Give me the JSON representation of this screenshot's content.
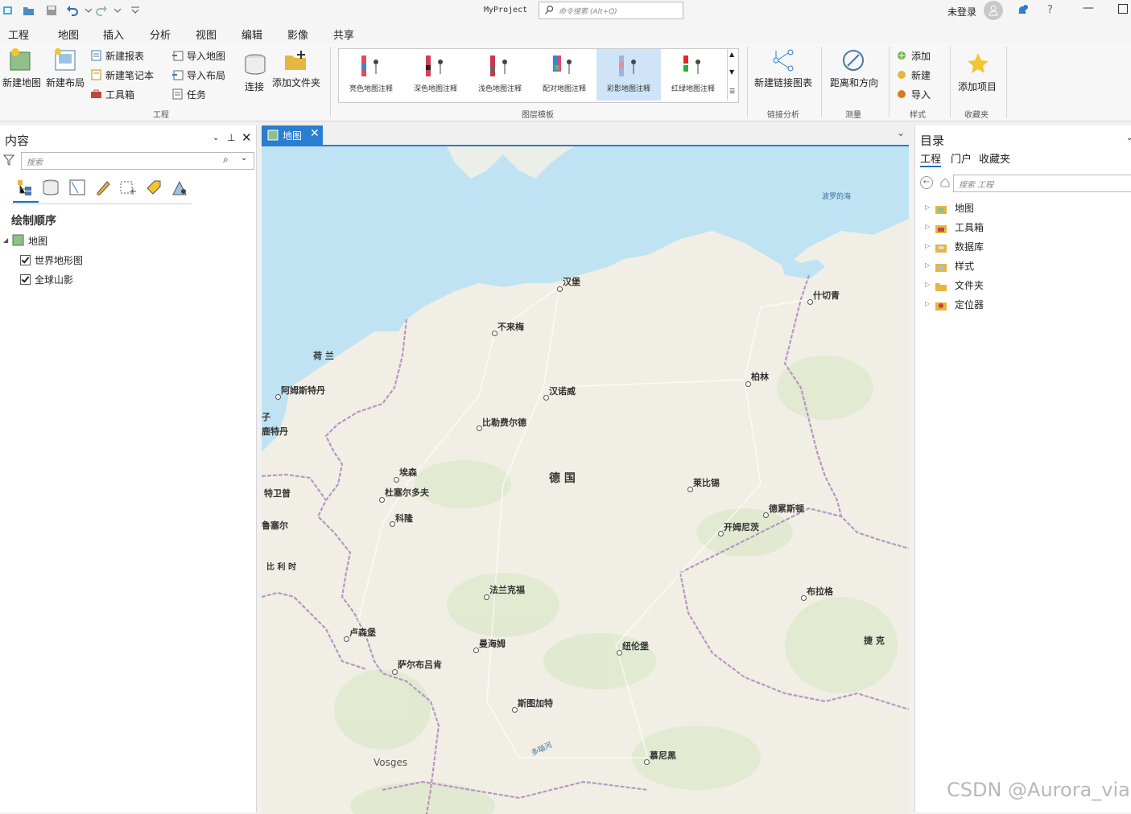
{
  "window": {
    "title": "MyProject",
    "command_search_placeholder": "命令搜索 (Alt+Q)",
    "login": "未登录"
  },
  "menu_tabs": [
    "工程",
    "地图",
    "插入",
    "分析",
    "视图",
    "编辑",
    "影像",
    "共享"
  ],
  "active_tab": "插入",
  "ribbon": {
    "project_group": {
      "new_map": "新建地图",
      "new_layout": "新建布局",
      "new_report": "新建报表",
      "new_notebook": "新建笔记本",
      "toolbox": "工具箱",
      "import_map": "导入地图",
      "import_layout": "导入布局",
      "task": "任务",
      "connect": "连接",
      "add_folder": "添加文件夹",
      "group_label": "工程"
    },
    "templates": {
      "items": [
        "亮色地图注释",
        "深色地图注释",
        "浅色地图注释",
        "配对地图注释",
        "彩影地图注释",
        "红绿地图注释"
      ],
      "selected": "彩影地图注释",
      "group_label": "图层模板"
    },
    "link": {
      "new_link_chart": "新建链接图表",
      "group_label": "链接分析"
    },
    "measure": {
      "distance_direction": "距离和方向",
      "group_label": "测量"
    },
    "styles": {
      "add": "添加",
      "new": "新建",
      "import": "导入",
      "group_label": "样式"
    },
    "favorites": {
      "add_item": "添加项目",
      "group_label": "收藏夹"
    }
  },
  "contents_pane": {
    "title": "内容",
    "search_placeholder": "搜索",
    "drawing_order_header": "绘制顺序",
    "map_name": "地图",
    "layers": [
      {
        "name": "世界地形图",
        "checked": true
      },
      {
        "name": "全球山影",
        "checked": true
      }
    ]
  },
  "map_view": {
    "tab_label": "地图",
    "labels": {
      "sea": "波罗的海",
      "hamburg": "汉堡",
      "bremen": "不来梅",
      "szczecin": "什切青",
      "netherlands": "荷 兰",
      "amsterdam": "阿姆斯特丹",
      "hanover": "汉诺威",
      "berlin": "柏林",
      "bielefeld": "比勒费尔德",
      "rotterdam_part": "鹿特丹",
      "cut_top": "子",
      "essen": "埃森",
      "germany": "德 国",
      "duesseldorf": "杜塞尔多夫",
      "antwerp_part": "特卫普",
      "leipzig": "莱比锡",
      "cologne": "科隆",
      "dresden": "德累斯顿",
      "brussels_part": "鲁塞尔",
      "chemnitz": "开姆尼茨",
      "belgium": "比 利 时",
      "prague": "布拉格",
      "frankfurt": "法兰克福",
      "luxembourg": "卢森堡",
      "czech": "捷 克",
      "mannheim": "曼海姆",
      "nuremberg": "纽伦堡",
      "saarbruecken": "萨尔布吕肯",
      "stuttgart": "斯图加特",
      "danube": "多瑙河",
      "vosges": "Vosges",
      "munich": "慕尼黑"
    }
  },
  "catalog_pane": {
    "title": "目录",
    "tabs": [
      "工程",
      "门户",
      "收藏夹"
    ],
    "active_tab": "工程",
    "search_placeholder": "搜索 工程",
    "items": [
      "地图",
      "工具箱",
      "数据库",
      "样式",
      "文件夹",
      "定位器"
    ]
  },
  "watermark": "CSDN @Aurora_via",
  "colors": {
    "accent": "#2a7dd0",
    "water": "#bfe3f2",
    "land": "#f1efe5",
    "border": "#b28dc2"
  }
}
